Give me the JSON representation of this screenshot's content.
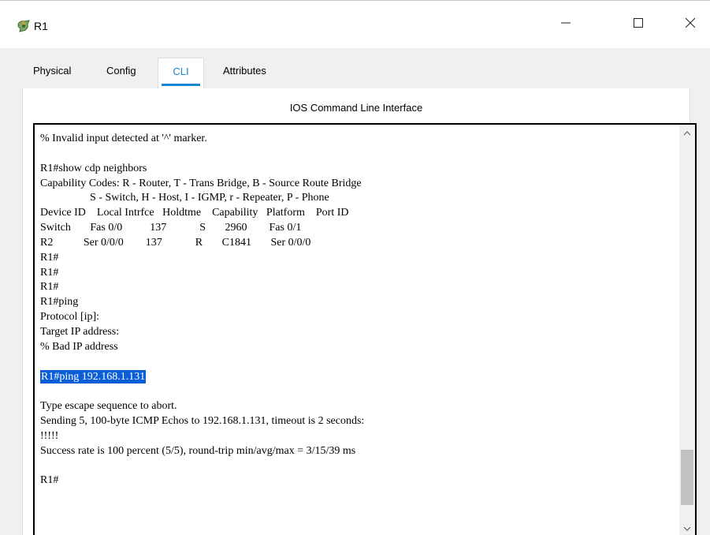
{
  "window": {
    "title": "R1",
    "icon": "router-icon",
    "controls": {
      "minimize": "—",
      "maximize": "☐",
      "close": "✕"
    }
  },
  "tabs": [
    {
      "label": "Physical",
      "active": false
    },
    {
      "label": "Config",
      "active": false
    },
    {
      "label": "CLI",
      "active": true
    },
    {
      "label": "Attributes",
      "active": false
    }
  ],
  "panel": {
    "title": "IOS Command Line Interface"
  },
  "console": {
    "lines": [
      "% Invalid input detected at '^' marker.",
      "",
      "R1#show cdp neighbors",
      "Capability Codes: R - Router, T - Trans Bridge, B - Source Route Bridge",
      "                  S - Switch, H - Host, I - IGMP, r - Repeater, P - Phone",
      "Device ID    Local Intrfce   Holdtme    Capability   Platform    Port ID",
      "Switch       Fas 0/0          137            S       2960        Fas 0/1",
      "R2           Ser 0/0/0        137            R       C1841       Ser 0/0/0",
      "R1#",
      "R1#",
      "R1#",
      "R1#ping",
      "Protocol [ip]:",
      "Target IP address:",
      "% Bad IP address",
      "",
      "R1#ping 192.168.1.131",
      "",
      "Type escape sequence to abort.",
      "Sending 5, 100-byte ICMP Echos to 192.168.1.131, timeout is 2 seconds:",
      "!!!!!",
      "Success rate is 100 percent (5/5), round-trip min/avg/max = 3/15/39 ms",
      "",
      "R1#"
    ],
    "highlighted_line": "R1#ping 192.168.1.131",
    "scroll_position": 0.95,
    "colors": {
      "highlight": "#0a5fd6",
      "active_tab": "#1a86d4"
    }
  }
}
